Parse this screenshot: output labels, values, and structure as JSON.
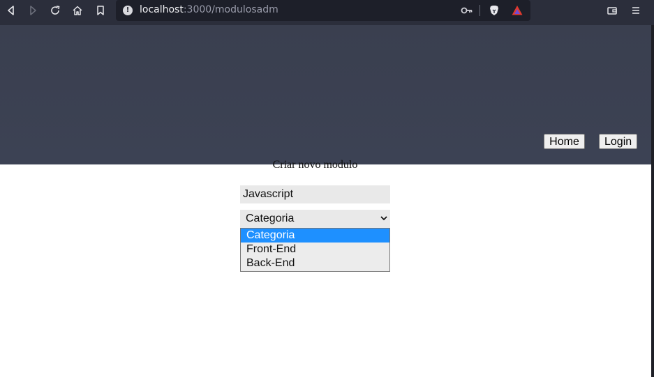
{
  "browser": {
    "url_host": "localhost",
    "url_path": ":3000/modulosadm",
    "info_icon": "info-icon",
    "toolbar_icons": [
      "back-icon",
      "forward-icon",
      "reload-icon",
      "home-icon",
      "bookmark-icon",
      "key-icon",
      "brave-shield-icon",
      "brave-rewards-icon",
      "wallet-icon",
      "menu-icon"
    ]
  },
  "header": {
    "nav": [
      {
        "label": "Home"
      },
      {
        "label": "Login"
      }
    ]
  },
  "form": {
    "title": "Criar novo modulo",
    "name_value": "Javascript",
    "category_selected": "Categoria",
    "category_options": [
      {
        "label": "Categoria",
        "selected": true
      },
      {
        "label": "Front-End",
        "selected": false
      },
      {
        "label": "Back-End",
        "selected": false
      }
    ]
  },
  "colors": {
    "header_bg": "#3b4051",
    "toolbar_bg": "#2b2e3b",
    "option_highlight": "#1e90ff"
  }
}
